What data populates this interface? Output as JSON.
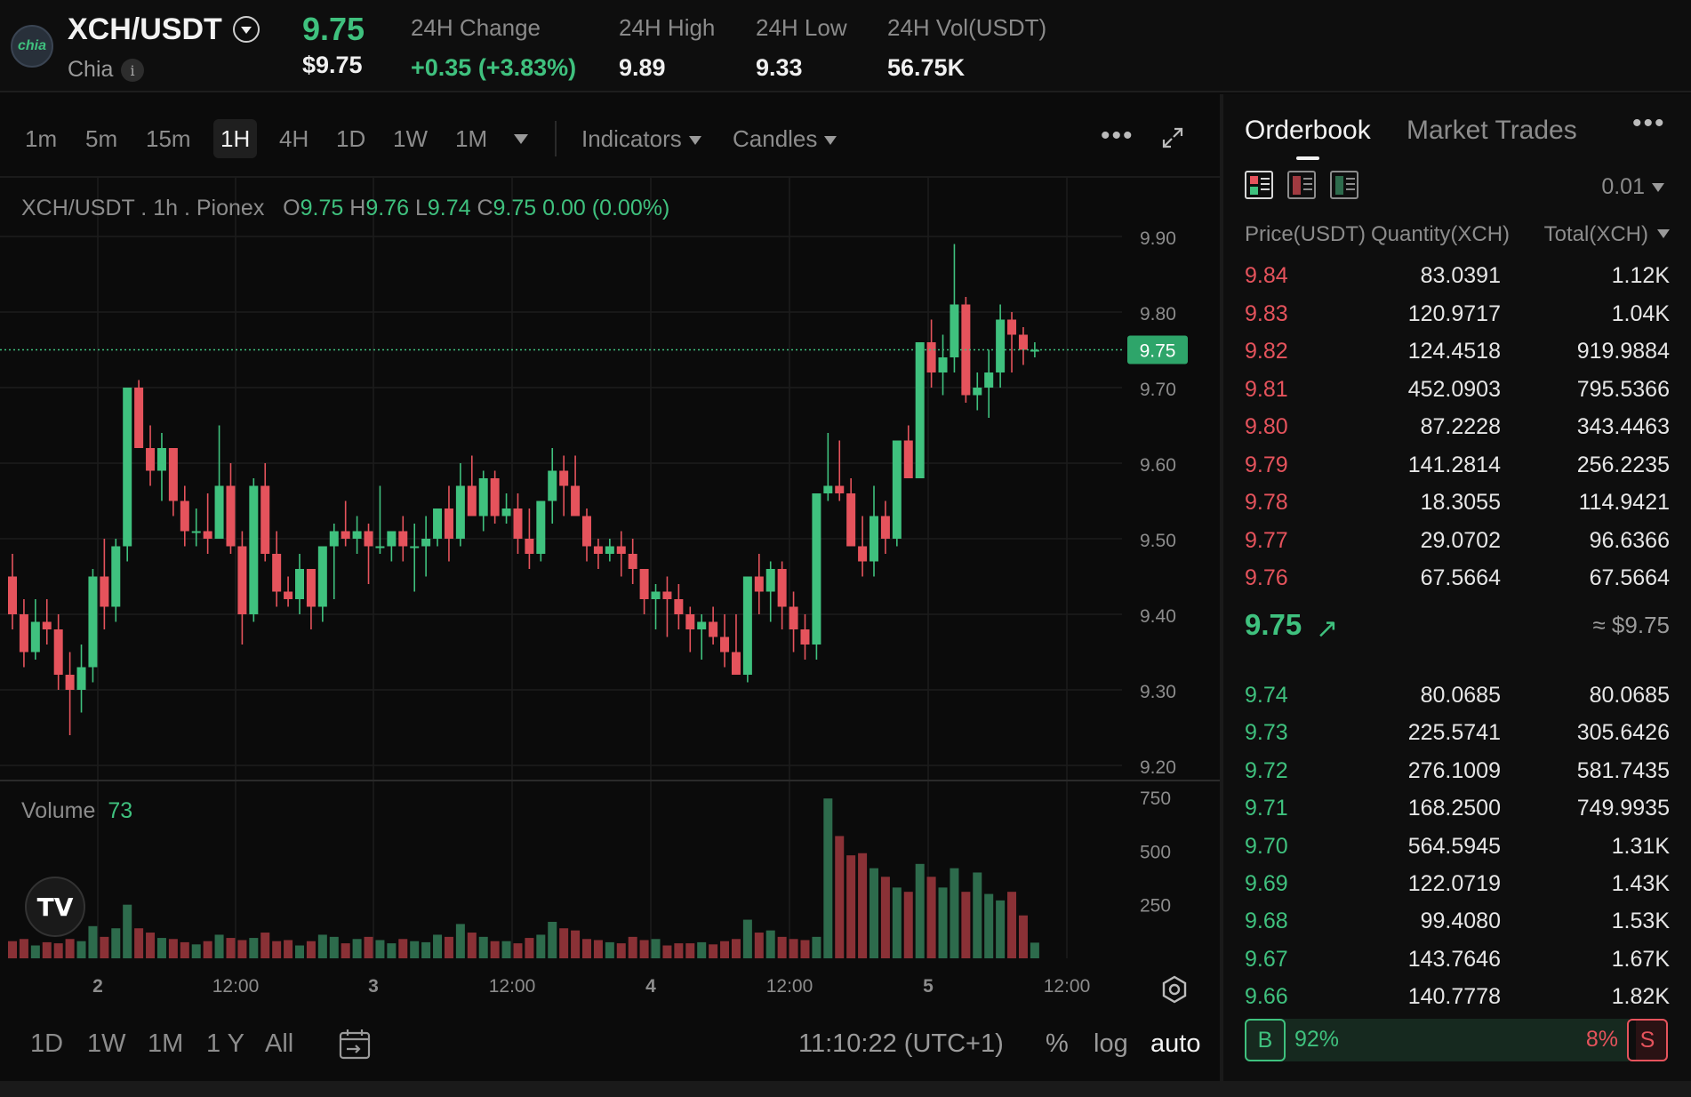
{
  "header": {
    "logo_text": "chia",
    "pair": "XCH/USDT",
    "coin_name": "Chia",
    "info_icon": "i",
    "last_price": "9.75",
    "last_price_usd": "$9.75",
    "stats": [
      {
        "label": "24H Change",
        "value": "+0.35 (+3.83%)",
        "green": true
      },
      {
        "label": "24H High",
        "value": "9.89",
        "green": false
      },
      {
        "label": "24H Low",
        "value": "9.33",
        "green": false
      },
      {
        "label": "24H Vol(USDT)",
        "value": "56.75K",
        "green": false
      }
    ]
  },
  "toolbar": {
    "timeframes": [
      "1m",
      "5m",
      "15m",
      "1H",
      "4H",
      "1D",
      "1W",
      "1M"
    ],
    "active_timeframe": "1H",
    "indicators_label": "Indicators",
    "candles_label": "Candles"
  },
  "legend": {
    "symbol": "XCH/USDT",
    "interval": "1h",
    "exchange": "Pionex",
    "o_label": "O",
    "o": "9.75",
    "h_label": "H",
    "h": "9.76",
    "l_label": "L",
    "l": "9.74",
    "c_label": "C",
    "c": "9.75",
    "change": "0.00 (0.00%)"
  },
  "volume_legend": {
    "label": "Volume",
    "value": "73"
  },
  "tv_logo": "TV",
  "range_bar": {
    "ranges": [
      "1D",
      "1W",
      "1M",
      "1 Y",
      "All"
    ],
    "clock": "11:10:22 (UTC+1)",
    "percent": "%",
    "log": "log",
    "auto": "auto"
  },
  "colors": {
    "up": "#3fc17e",
    "down": "#e5535c",
    "vol_up": "#2d6b4c",
    "vol_down": "#8a3136"
  },
  "chart_data": {
    "type": "candlestick",
    "price_axis": {
      "ticks": [
        9.9,
        9.8,
        9.7,
        9.6,
        9.5,
        9.4,
        9.3,
        9.2
      ],
      "labels": [
        "9.90",
        "9.80",
        "9.70",
        "9.60",
        "9.50",
        "9.40",
        "9.30",
        "9.20"
      ],
      "range": [
        9.18,
        9.92
      ]
    },
    "volume_axis": {
      "ticks": [
        750,
        500,
        250
      ],
      "labels": [
        "750",
        "500",
        "250"
      ],
      "range": [
        0,
        760
      ]
    },
    "x_axis_labels": [
      "2",
      "12:00",
      "3",
      "12:00",
      "4",
      "12:00",
      "5",
      "12:00"
    ],
    "current_price": 9.75,
    "current_price_label": "9.75",
    "candles_ohlc": [
      [
        9.45,
        9.48,
        9.38,
        9.4
      ],
      [
        9.4,
        9.42,
        9.33,
        9.35
      ],
      [
        9.35,
        9.42,
        9.34,
        9.39
      ],
      [
        9.39,
        9.42,
        9.36,
        9.38
      ],
      [
        9.38,
        9.4,
        9.3,
        9.32
      ],
      [
        9.32,
        9.35,
        9.24,
        9.3
      ],
      [
        9.3,
        9.36,
        9.27,
        9.33
      ],
      [
        9.33,
        9.46,
        9.31,
        9.45
      ],
      [
        9.45,
        9.5,
        9.38,
        9.41
      ],
      [
        9.41,
        9.5,
        9.39,
        9.49
      ],
      [
        9.49,
        9.7,
        9.47,
        9.7
      ],
      [
        9.7,
        9.71,
        9.62,
        9.62
      ],
      [
        9.62,
        9.65,
        9.57,
        9.59
      ],
      [
        9.59,
        9.64,
        9.55,
        9.62
      ],
      [
        9.62,
        9.62,
        9.53,
        9.55
      ],
      [
        9.55,
        9.57,
        9.49,
        9.51
      ],
      [
        9.51,
        9.54,
        9.49,
        9.51
      ],
      [
        9.51,
        9.56,
        9.48,
        9.5
      ],
      [
        9.5,
        9.65,
        9.5,
        9.57
      ],
      [
        9.57,
        9.6,
        9.48,
        9.49
      ],
      [
        9.49,
        9.51,
        9.36,
        9.4
      ],
      [
        9.4,
        9.58,
        9.39,
        9.57
      ],
      [
        9.57,
        9.6,
        9.47,
        9.48
      ],
      [
        9.48,
        9.51,
        9.41,
        9.43
      ],
      [
        9.43,
        9.45,
        9.41,
        9.42
      ],
      [
        9.42,
        9.48,
        9.4,
        9.46
      ],
      [
        9.46,
        9.46,
        9.38,
        9.41
      ],
      [
        9.41,
        9.49,
        9.39,
        9.49
      ],
      [
        9.49,
        9.52,
        9.42,
        9.51
      ],
      [
        9.51,
        9.55,
        9.49,
        9.5
      ],
      [
        9.5,
        9.53,
        9.48,
        9.51
      ],
      [
        9.51,
        9.52,
        9.44,
        9.49
      ],
      [
        9.49,
        9.57,
        9.48,
        9.49
      ],
      [
        9.49,
        9.51,
        9.47,
        9.51
      ],
      [
        9.51,
        9.53,
        9.47,
        9.49
      ],
      [
        9.49,
        9.52,
        9.43,
        9.49
      ],
      [
        9.49,
        9.53,
        9.45,
        9.5
      ],
      [
        9.5,
        9.54,
        9.49,
        9.54
      ],
      [
        9.54,
        9.57,
        9.47,
        9.5
      ],
      [
        9.5,
        9.6,
        9.49,
        9.57
      ],
      [
        9.57,
        9.61,
        9.53,
        9.53
      ],
      [
        9.53,
        9.59,
        9.51,
        9.58
      ],
      [
        9.58,
        9.59,
        9.52,
        9.53
      ],
      [
        9.53,
        9.56,
        9.52,
        9.54
      ],
      [
        9.54,
        9.56,
        9.48,
        9.5
      ],
      [
        9.5,
        9.54,
        9.46,
        9.48
      ],
      [
        9.48,
        9.55,
        9.47,
        9.55
      ],
      [
        9.55,
        9.62,
        9.52,
        9.59
      ],
      [
        9.59,
        9.61,
        9.53,
        9.57
      ],
      [
        9.57,
        9.61,
        9.53,
        9.53
      ],
      [
        9.53,
        9.54,
        9.47,
        9.49
      ],
      [
        9.49,
        9.5,
        9.46,
        9.48
      ],
      [
        9.48,
        9.5,
        9.47,
        9.49
      ],
      [
        9.49,
        9.51,
        9.45,
        9.48
      ],
      [
        9.48,
        9.5,
        9.44,
        9.46
      ],
      [
        9.46,
        9.46,
        9.4,
        9.42
      ],
      [
        9.42,
        9.44,
        9.38,
        9.43
      ],
      [
        9.43,
        9.45,
        9.37,
        9.42
      ],
      [
        9.42,
        9.44,
        9.38,
        9.4
      ],
      [
        9.4,
        9.41,
        9.35,
        9.38
      ],
      [
        9.38,
        9.4,
        9.34,
        9.39
      ],
      [
        9.39,
        9.41,
        9.36,
        9.37
      ],
      [
        9.37,
        9.4,
        9.33,
        9.35
      ],
      [
        9.35,
        9.4,
        9.32,
        9.32
      ],
      [
        9.32,
        9.45,
        9.31,
        9.45
      ],
      [
        9.45,
        9.48,
        9.4,
        9.43
      ],
      [
        9.43,
        9.47,
        9.39,
        9.46
      ],
      [
        9.46,
        9.47,
        9.38,
        9.41
      ],
      [
        9.41,
        9.43,
        9.35,
        9.38
      ],
      [
        9.38,
        9.4,
        9.34,
        9.36
      ],
      [
        9.36,
        9.56,
        9.34,
        9.56
      ],
      [
        9.56,
        9.64,
        9.55,
        9.57
      ],
      [
        9.57,
        9.63,
        9.55,
        9.56
      ],
      [
        9.56,
        9.58,
        9.49,
        9.49
      ],
      [
        9.49,
        9.53,
        9.45,
        9.47
      ],
      [
        9.47,
        9.57,
        9.45,
        9.53
      ],
      [
        9.53,
        9.55,
        9.48,
        9.5
      ],
      [
        9.5,
        9.63,
        9.49,
        9.63
      ],
      [
        9.63,
        9.65,
        9.58,
        9.58
      ],
      [
        9.58,
        9.76,
        9.58,
        9.76
      ],
      [
        9.76,
        9.79,
        9.7,
        9.72
      ],
      [
        9.72,
        9.77,
        9.69,
        9.74
      ],
      [
        9.74,
        9.89,
        9.72,
        9.81
      ],
      [
        9.81,
        9.82,
        9.68,
        9.69
      ],
      [
        9.69,
        9.72,
        9.67,
        9.7
      ],
      [
        9.7,
        9.75,
        9.66,
        9.72
      ],
      [
        9.72,
        9.81,
        9.7,
        9.79
      ],
      [
        9.79,
        9.8,
        9.72,
        9.77
      ],
      [
        9.77,
        9.78,
        9.73,
        9.75
      ],
      [
        9.75,
        9.76,
        9.74,
        9.75
      ]
    ],
    "volumes": [
      80,
      90,
      60,
      75,
      70,
      90,
      80,
      150,
      100,
      140,
      250,
      140,
      120,
      95,
      90,
      75,
      65,
      80,
      110,
      95,
      85,
      95,
      120,
      80,
      85,
      60,
      80,
      110,
      100,
      70,
      90,
      100,
      85,
      70,
      90,
      80,
      75,
      110,
      100,
      160,
      120,
      100,
      80,
      80,
      70,
      95,
      110,
      170,
      140,
      130,
      90,
      85,
      75,
      70,
      100,
      85,
      90,
      60,
      70,
      70,
      75,
      65,
      80,
      90,
      180,
      120,
      130,
      100,
      90,
      85,
      100,
      745,
      570,
      480,
      490,
      420,
      380,
      330,
      310,
      440,
      380,
      330,
      420,
      310,
      400,
      300,
      270,
      310,
      200,
      73
    ],
    "volume_unit": "XCH"
  },
  "orderbook": {
    "tabs": [
      "Orderbook",
      "Market Trades"
    ],
    "precision": "0.01",
    "headers": {
      "price": "Price(USDT)",
      "qty": "Quantity(XCH)",
      "total": "Total(XCH)"
    },
    "asks": [
      {
        "price": "9.84",
        "qty": "83.0391",
        "total": "1.12K"
      },
      {
        "price": "9.83",
        "qty": "120.9717",
        "total": "1.04K"
      },
      {
        "price": "9.82",
        "qty": "124.4518",
        "total": "919.9884"
      },
      {
        "price": "9.81",
        "qty": "452.0903",
        "total": "795.5366"
      },
      {
        "price": "9.80",
        "qty": "87.2228",
        "total": "343.4463"
      },
      {
        "price": "9.79",
        "qty": "141.2814",
        "total": "256.2235"
      },
      {
        "price": "9.78",
        "qty": "18.3055",
        "total": "114.9421"
      },
      {
        "price": "9.77",
        "qty": "29.0702",
        "total": "96.6366"
      },
      {
        "price": "9.76",
        "qty": "67.5664",
        "total": "67.5664"
      }
    ],
    "mid_price": "9.75",
    "mid_price_arrow": "↗",
    "mid_price_usd": "≈ $9.75",
    "bids": [
      {
        "price": "9.74",
        "qty": "80.0685",
        "total": "80.0685"
      },
      {
        "price": "9.73",
        "qty": "225.5741",
        "total": "305.6426"
      },
      {
        "price": "9.72",
        "qty": "276.1009",
        "total": "581.7435"
      },
      {
        "price": "9.71",
        "qty": "168.2500",
        "total": "749.9935"
      },
      {
        "price": "9.70",
        "qty": "564.5945",
        "total": "1.31K"
      },
      {
        "price": "9.69",
        "qty": "122.0719",
        "total": "1.43K"
      },
      {
        "price": "9.68",
        "qty": "99.4080",
        "total": "1.53K"
      },
      {
        "price": "9.67",
        "qty": "143.7646",
        "total": "1.67K"
      },
      {
        "price": "9.66",
        "qty": "140.7778",
        "total": "1.82K"
      }
    ],
    "ratio": {
      "buy_label": "B",
      "buy_pct": "92%",
      "buy_value": 92,
      "sell_label": "S",
      "sell_pct": "8%",
      "sell_value": 8
    }
  }
}
